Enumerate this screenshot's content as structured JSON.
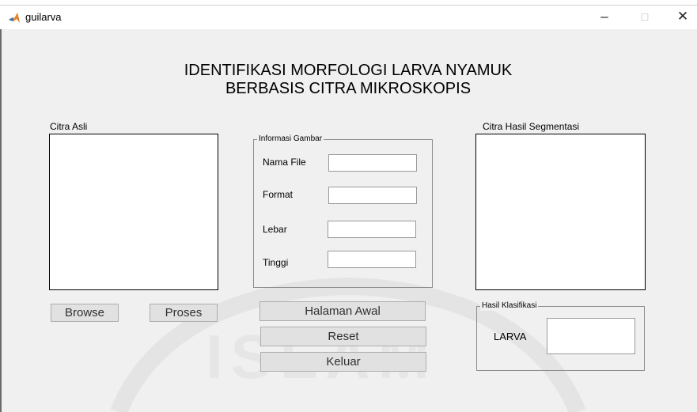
{
  "window": {
    "title": "guilarva",
    "controls": {
      "minimize": "–",
      "maximize": "□",
      "close": "✕"
    }
  },
  "header": {
    "line1": "IDENTIFIKASI MORFOLOGI  LARVA NYAMUK",
    "line2": "BERBASIS CITRA MIKROSKOPIS"
  },
  "left_axes": {
    "label": "Citra Asli"
  },
  "right_axes": {
    "label": "Citra Hasil Segmentasi"
  },
  "info_panel": {
    "title": "Informasi Gambar",
    "fields": [
      {
        "label": "Nama File",
        "value": ""
      },
      {
        "label": "Format",
        "value": ""
      },
      {
        "label": "Lebar",
        "value": ""
      },
      {
        "label": "Tinggi",
        "value": ""
      }
    ]
  },
  "buttons": {
    "browse": "Browse",
    "proses": "Proses",
    "halaman_awal": "Halaman Awal",
    "reset": "Reset",
    "keluar": "Keluar"
  },
  "classification_panel": {
    "title": "Hasil Klasifikasi",
    "label": "LARVA",
    "value": ""
  },
  "colors": {
    "background": "#f0f0f0",
    "button": "#e1e1e1",
    "app_icon_accent": "#e8862a"
  },
  "icons": {
    "app": "matlab-logo-icon"
  }
}
